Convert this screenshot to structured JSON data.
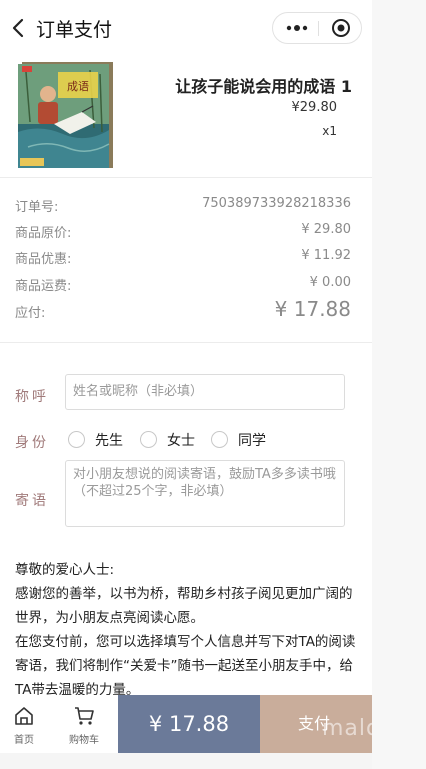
{
  "header": {
    "title": "订单支付"
  },
  "product": {
    "cover_text": "让孩子能说会用的成语",
    "title": "让孩子能说会用的成语 1",
    "price": "¥29.80",
    "quantity": "x1"
  },
  "order": {
    "rows": [
      {
        "label": "订单号:",
        "value": "750389733928218336"
      },
      {
        "label": "商品原价:",
        "value": "¥ 29.80"
      },
      {
        "label": "商品优惠:",
        "value": "¥ 11.92"
      },
      {
        "label": "商品运费:",
        "value": "¥ 0.00"
      },
      {
        "label": "应付:",
        "value": "¥ 17.88"
      }
    ]
  },
  "form": {
    "name_label": "称呼",
    "name_placeholder": "姓名或昵称（非必填）",
    "identity_label": "身份",
    "identity_options": [
      "先生",
      "女士",
      "同学"
    ],
    "message_label": "寄语",
    "message_placeholder": "对小朋友想说的阅读寄语，鼓励TA多多读书哦（不超过25个字，非必填）"
  },
  "message": {
    "greeting": "尊敬的爱心人士:",
    "paragraph1": "感谢您的善举，以书为桥，帮助乡村孩子阅见更加广阔的世界，为小朋友点亮阅读心愿。",
    "paragraph2": "在您支付前，您可以选择填写个人信息并写下对TA的阅读寄语，我们将制作“关爱卡”随书一起送至小朋友手中，给TA带去温暖的力量。"
  },
  "bottom": {
    "home_label": "首页",
    "cart_label": "购物车",
    "amount": "¥ 17.88",
    "pay_label": "支付"
  },
  "colors": {
    "form_border": "#d9302a",
    "amount_button": "#6b7a99",
    "pay_button": "#c9ad9b"
  }
}
